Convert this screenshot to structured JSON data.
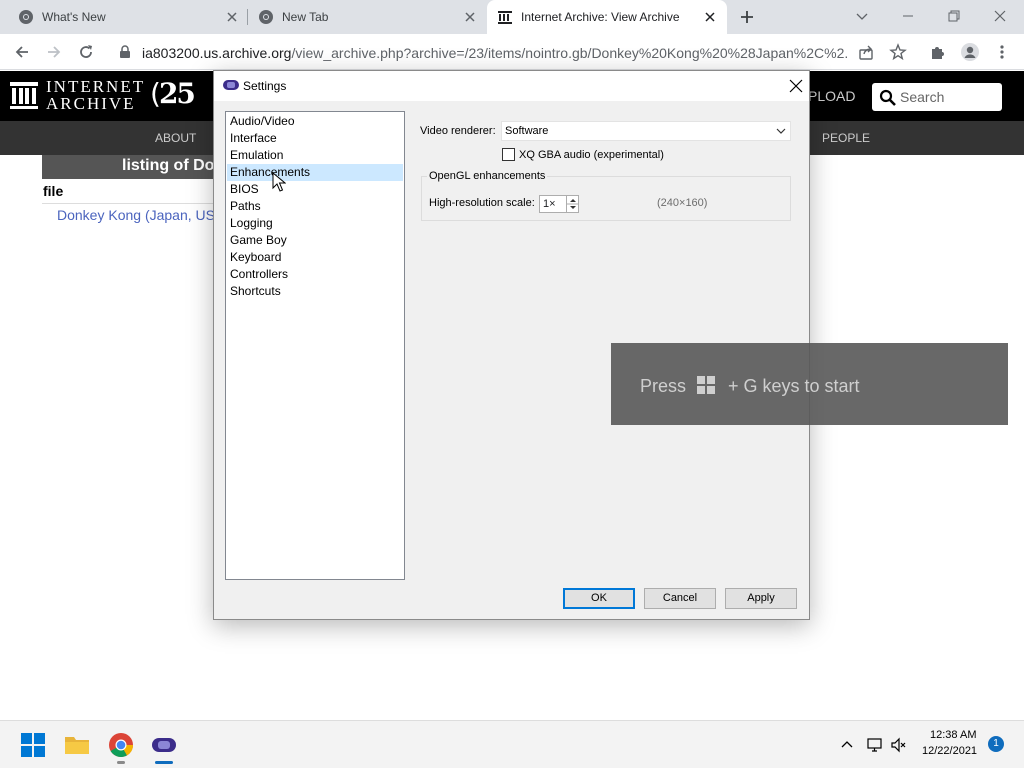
{
  "browser": {
    "tabs": [
      {
        "title": "What's New",
        "icon": "chrome-icon",
        "active": false
      },
      {
        "title": "New Tab",
        "icon": "chrome-icon",
        "active": false
      },
      {
        "title": "Internet Archive: View Archive",
        "icon": "internet-archive-icon",
        "active": true
      }
    ],
    "address": {
      "host": "ia803200.us.archive.org",
      "path": "/view_archive.php?archive=/23/items/nointro.gb/Donkey%20Kong%20%28Japan%2C%2..."
    }
  },
  "page": {
    "logo_line1": "INTERNET",
    "logo_line2": "ARCHIVE",
    "anniversary": "25",
    "upload_text": "PLOAD",
    "search_placeholder": "Search",
    "nav_about": "ABOUT",
    "nav_people": "PEOPLE",
    "listing_title": "listing of Do",
    "file_header": "file",
    "file_link": "Donkey Kong (Japan, US"
  },
  "dialog": {
    "title": "Settings",
    "categories": [
      "Audio/Video",
      "Interface",
      "Emulation",
      "Enhancements",
      "BIOS",
      "Paths",
      "Logging",
      "Game Boy",
      "Keyboard",
      "Controllers",
      "Shortcuts"
    ],
    "selected_category": "Enhancements",
    "video_renderer_label": "Video renderer:",
    "video_renderer_value": "Software",
    "xq_audio_label": "XQ GBA audio (experimental)",
    "xq_audio_checked": false,
    "opengl_group_title": "OpenGL enhancements",
    "hires_label": "High-resolution scale:",
    "hires_value": "1×",
    "hires_note": "(240×160)",
    "ok_label": "OK",
    "cancel_label": "Cancel",
    "apply_label": "Apply"
  },
  "gamebar": {
    "text_before": "Press",
    "text_after": "+ G keys to start"
  },
  "taskbar": {
    "time": "12:38 AM",
    "date": "12/22/2021",
    "notification_count": "1"
  },
  "colors": {
    "selection": "#cce8ff",
    "default_button_border": "#0078d7",
    "link": "#4b64be",
    "ia_header": "#000000",
    "ia_nav": "#333333"
  }
}
